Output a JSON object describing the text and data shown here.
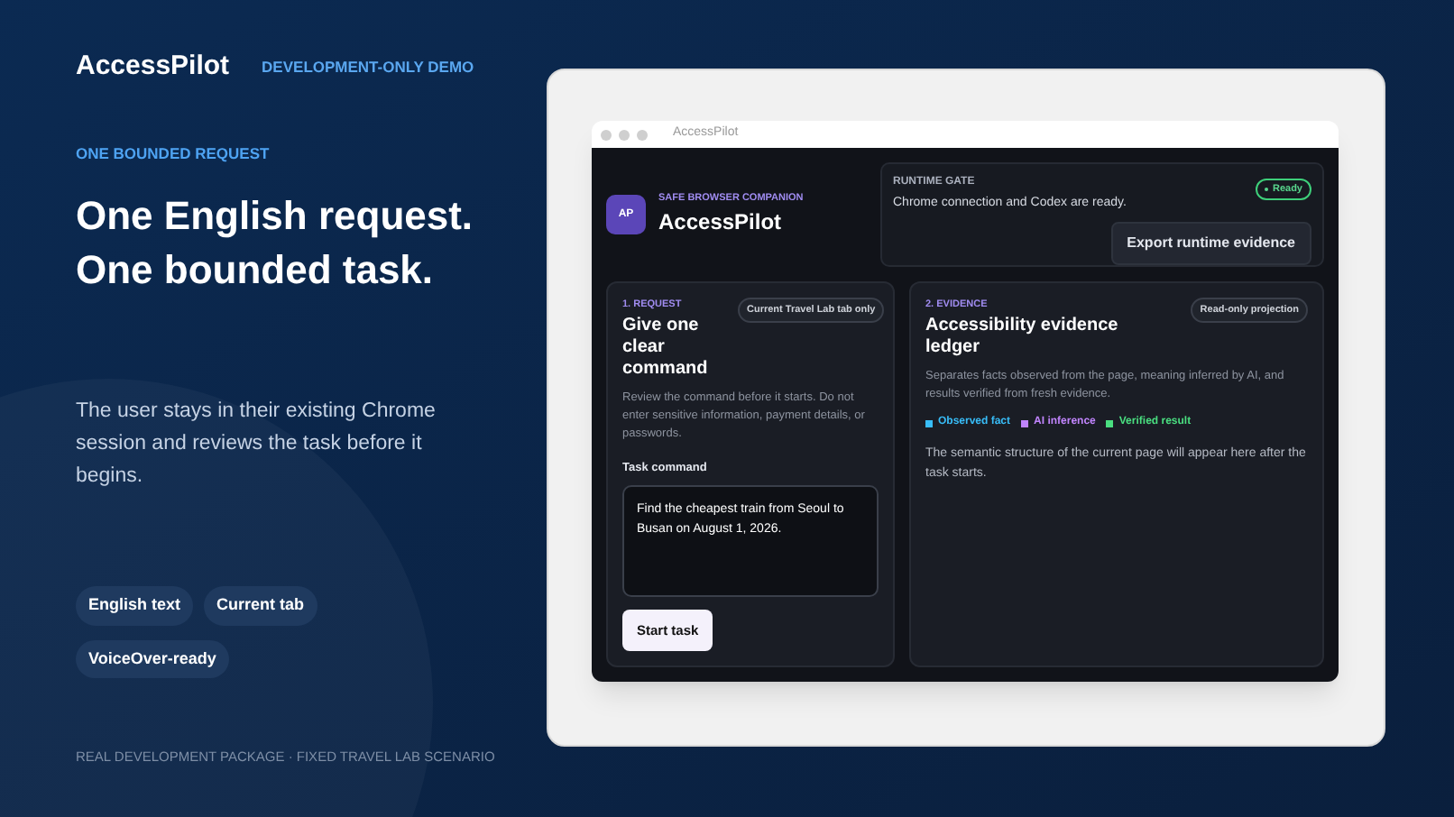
{
  "brand": "AccessPilot",
  "brand_tag": "DEVELOPMENT-ONLY DEMO",
  "eyebrow": "ONE BOUNDED REQUEST",
  "headline": [
    "One English request.",
    "One bounded task."
  ],
  "description": "The user stays in their existing Chrome session and reviews the task before it begins.",
  "chips": [
    "English text",
    "Current tab",
    "VoiceOver-ready"
  ],
  "footer": "REAL DEVELOPMENT PACKAGE · FIXED TRAVEL LAB SCENARIO",
  "app_window": {
    "title": "AccessPilot",
    "app": {
      "logo": "AP",
      "subtitle": "SAFE BROWSER COMPANION",
      "name": "AccessPilot"
    },
    "runtime_gate": {
      "label": "RUNTIME GATE",
      "message": "Chrome connection and Codex are ready.",
      "status": "Ready",
      "ready": true,
      "button": "Export runtime evidence"
    },
    "request": {
      "step": "1. REQUEST",
      "badge": "Current Travel Lab tab only",
      "title": "Give one clear command",
      "body": "Review the command before it starts. Do not enter sensitive information, payment details, or passwords.",
      "field_label": "Task command",
      "field_value": "Find the cheapest train from Seoul to Busan on August 1, 2026.",
      "button": "Start task"
    },
    "evidence": {
      "step": "2. EVIDENCE",
      "badge": "Read-only projection",
      "title": "Accessibility evidence ledger",
      "body": "Separates facts observed from the page, meaning inferred by AI, and results verified from fresh evidence.",
      "legend": [
        {
          "label": "Observed fact",
          "color": "#38bdf8"
        },
        {
          "label": "AI inference",
          "color": "#c084fc"
        },
        {
          "label": "Verified result",
          "color": "#4ade80"
        }
      ],
      "empty": "The semantic structure of the current page will appear here after the task starts."
    }
  }
}
